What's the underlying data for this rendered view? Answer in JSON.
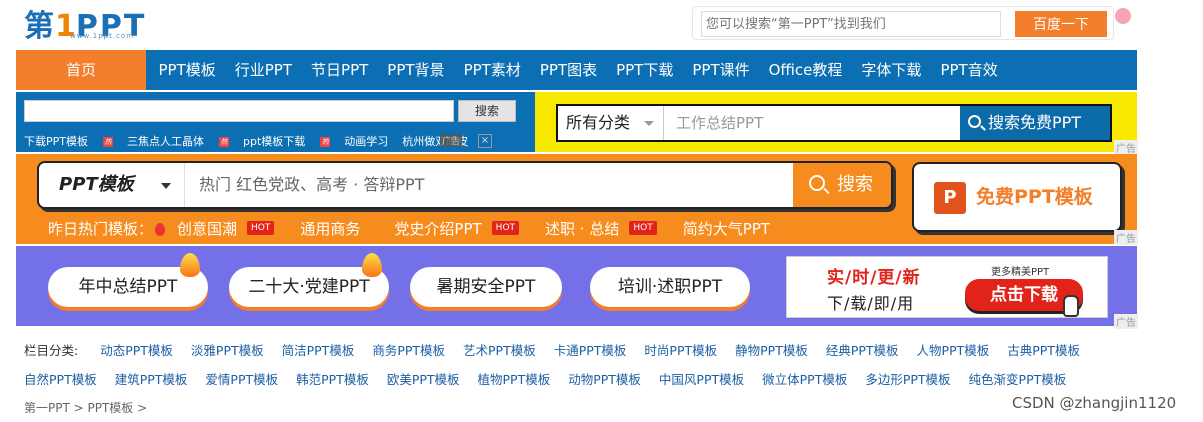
{
  "logo": {
    "part1": "第",
    "part2": "1",
    "part3": "PPT",
    "url": "www.1ppt.com"
  },
  "top_search": {
    "placeholder": "您可以搜索“第一PPT”找到我们",
    "button": "百度一下"
  },
  "nav": {
    "home": "首页",
    "items": [
      "PPT模板",
      "行业PPT",
      "节日PPT",
      "PPT背景",
      "PPT素材",
      "PPT图表",
      "PPT下载",
      "PPT课件",
      "Office教程",
      "字体下载",
      "PPT音效"
    ]
  },
  "ad_strip": {
    "search_button": "搜索",
    "hot_links": [
      "下载PPT模板",
      "三焦点人工晶体",
      "ppt模板下载",
      "动画学习",
      "杭州做双眼皮"
    ],
    "ad_tag": "广告",
    "hot_icon": "热"
  },
  "category_search": {
    "category": "所有分类",
    "placeholder": "工作总结PPT",
    "button": "搜索免费PPT",
    "icon": "search-icon"
  },
  "ppt_search": {
    "category": "PPT模板",
    "placeholder": "热门 红色党政、高考 · 答辩PPT",
    "button": "搜索",
    "icon": "search-icon"
  },
  "free_template": {
    "icon_letter": "P",
    "label": "免费PPT模板"
  },
  "yesterday": {
    "label": "昨日热门模板：",
    "items": [
      {
        "text": "创意国潮",
        "hot": "HOT"
      },
      {
        "text": "通用商务",
        "hot": ""
      },
      {
        "text": "党史介绍PPT",
        "hot": "HOT"
      },
      {
        "text": "述职 · 总结",
        "hot": "HOT"
      },
      {
        "text": "简约大气PPT",
        "hot": ""
      }
    ]
  },
  "pills": [
    "年中总结PPT",
    "二十大·党建PPT",
    "暑期安全PPT",
    "培训·述职PPT"
  ],
  "download_ad": {
    "line1": "实/时/更/新",
    "line2": "下/载/即/用",
    "more": "更多精美PPT",
    "button": "点击下载"
  },
  "ad_labels": [
    "广告",
    "广告",
    "广告"
  ],
  "categories": {
    "label": "栏目分类:",
    "items": [
      "动态PPT模板",
      "淡雅PPT模板",
      "简洁PPT模板",
      "商务PPT模板",
      "艺术PPT模板",
      "卡通PPT模板",
      "时尚PPT模板",
      "静物PPT模板",
      "经典PPT模板",
      "人物PPT模板",
      "古典PPT模板",
      "自然PPT模板",
      "建筑PPT模板",
      "爱情PPT模板",
      "韩范PPT模板",
      "欧美PPT模板",
      "植物PPT模板",
      "动物PPT模板",
      "中国风PPT模板",
      "微立体PPT模板",
      "多边形PPT模板",
      "纯色渐变PPT模板"
    ]
  },
  "breadcrumb": "第一PPT > PPT模板 >",
  "watermark": "CSDN @zhangjin1120",
  "colors": {
    "nav_blue": "#0c6fb3",
    "accent_orange": "#f37e2b",
    "band_orange": "#f68c1e",
    "band_purple": "#7470e8",
    "band_yellow": "#f7e900",
    "hot_red": "#e2231a"
  }
}
